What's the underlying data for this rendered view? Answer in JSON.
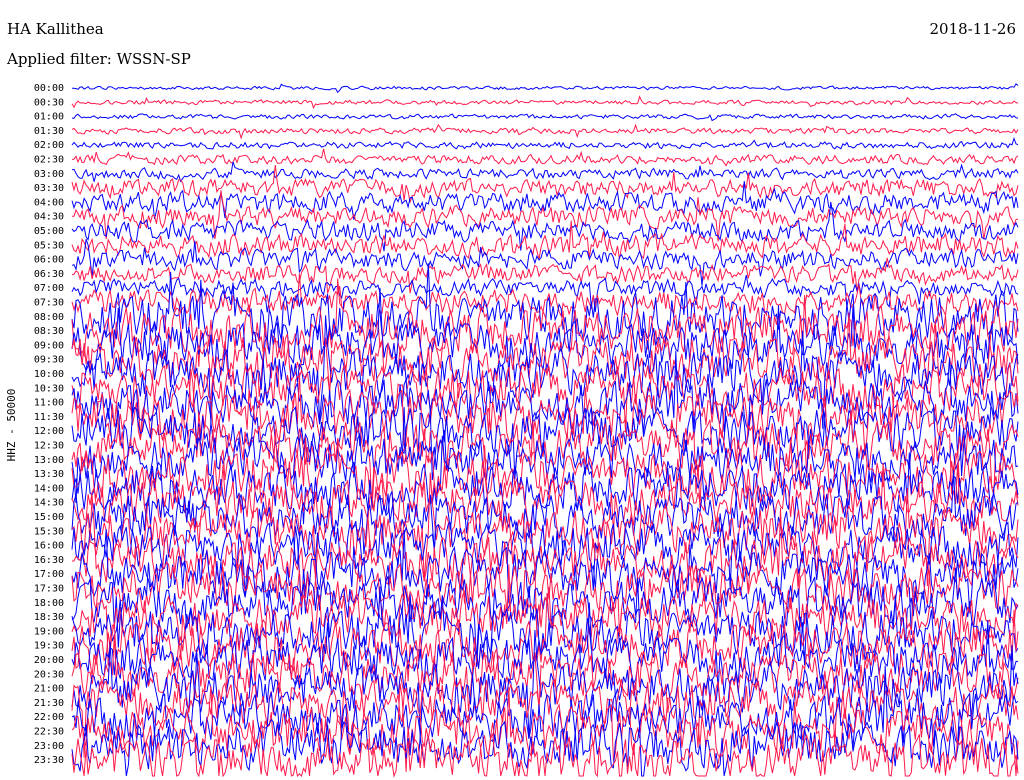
{
  "header": {
    "station": "HA Kallithea",
    "filter_label": "Applied filter:",
    "filter_value": "WSSN-SP",
    "date": "2018-11-26"
  },
  "chart_data": {
    "type": "line",
    "title": "HA Kallithea",
    "subtitle": "Applied filter: WSSN-SP",
    "date": "2018-11-26",
    "ylabel": "HHZ - 50000",
    "xlabel": "",
    "row_interval_minutes": 30,
    "row_labels": [
      "00:00",
      "00:30",
      "01:00",
      "01:30",
      "02:00",
      "02:30",
      "03:00",
      "03:30",
      "04:00",
      "04:30",
      "05:00",
      "05:30",
      "06:00",
      "06:30",
      "07:00",
      "07:30",
      "08:00",
      "08:30",
      "09:00",
      "09:30",
      "10:00",
      "10:30",
      "11:00",
      "11:30",
      "12:00",
      "12:30",
      "13:00",
      "13:30",
      "14:00",
      "14:30",
      "15:00",
      "15:30",
      "16:00",
      "16:30",
      "17:00",
      "17:30",
      "18:00",
      "18:30",
      "19:00",
      "19:30",
      "20:00",
      "20:30",
      "21:00",
      "21:30",
      "22:00",
      "22:30",
      "23:00",
      "23:30"
    ],
    "trace_colors": [
      "#0000ff",
      "#ff1a4d"
    ],
    "relative_amplitude_by_row": [
      0.3,
      0.4,
      0.4,
      0.5,
      0.6,
      0.8,
      0.9,
      1.6,
      1.8,
      1.8,
      1.8,
      1.9,
      1.7,
      1.6,
      1.5,
      2.2,
      4,
      4,
      4,
      4,
      4,
      4,
      4,
      4,
      4,
      4,
      4,
      4,
      4,
      4,
      4,
      4,
      4,
      4,
      4,
      4,
      4,
      4,
      4,
      4,
      4,
      4,
      4,
      4,
      4,
      4,
      4,
      4
    ]
  }
}
